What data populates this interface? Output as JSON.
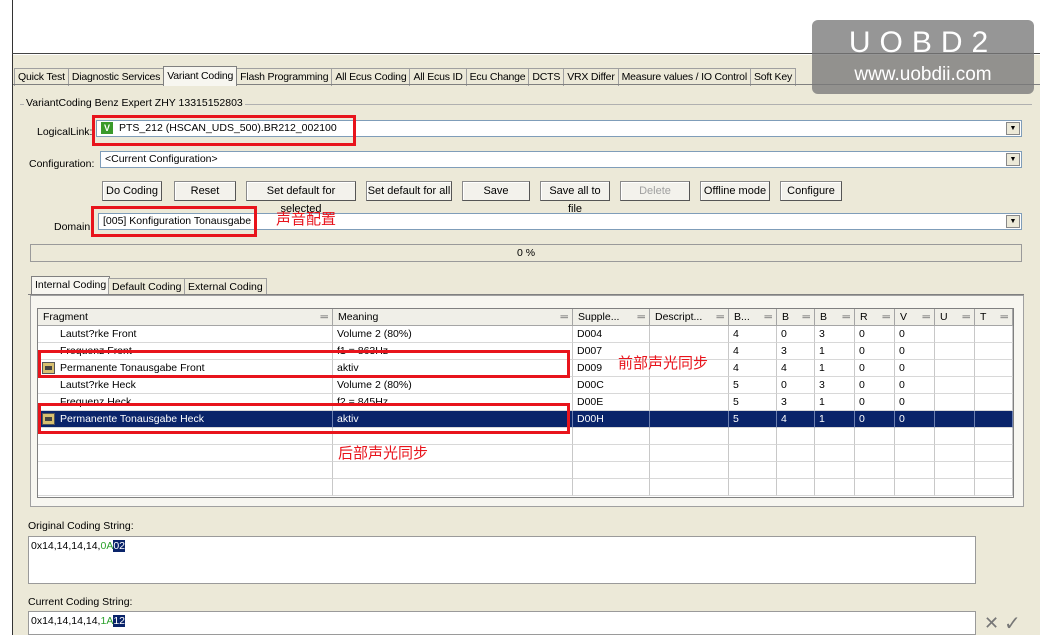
{
  "tabs": [
    "Quick Test",
    "Diagnostic Services",
    "Variant Coding",
    "Flash Programming",
    "All Ecus Coding",
    "All Ecus ID",
    "Ecu Change",
    "DCTS",
    "VRX Differ",
    "Measure values / IO Control",
    "Soft Key"
  ],
  "active_tab": "Variant Coding",
  "group_title": "VariantCoding Benz Expert ZHY 13315152803",
  "logical_link": {
    "label": "LogicalLink:",
    "badge": "V",
    "value": "PTS_212 (HSCAN_UDS_500).BR212_002100"
  },
  "configuration": {
    "label": "Configuration:",
    "value": "<Current Configuration>"
  },
  "buttons": {
    "do_coding": "Do Coding",
    "reset": "Reset",
    "set_default_selected": "Set default for selected",
    "set_default_all": "Set default for all",
    "save": "Save",
    "save_all": "Save all to file",
    "delete": "Delete",
    "offline": "Offline mode",
    "configure": "Configure"
  },
  "domain": {
    "label": "Domain:",
    "value": "[005] Konfiguration Tonausgabe"
  },
  "progress": {
    "value": 0,
    "text": "0 %"
  },
  "inner_tabs": [
    "Internal Coding",
    "Default Coding",
    "External Coding"
  ],
  "grid": {
    "columns": [
      "Fragment",
      "Meaning",
      "Supple...",
      "Descript...",
      "B...",
      "B",
      "B",
      "R",
      "V",
      "U",
      "T"
    ],
    "rows": [
      [
        "Lautst?rke Front",
        "Volume 2 (80%)",
        "D004",
        "",
        "4",
        "0",
        "3",
        "0",
        "0",
        "",
        ""
      ],
      [
        "Frequenz Front",
        "f1 = 863Hz",
        "D007",
        "",
        "4",
        "3",
        "1",
        "0",
        "0",
        "",
        ""
      ],
      [
        "Permanente Tonausgabe Front",
        "aktiv",
        "D009",
        "",
        "4",
        "4",
        "1",
        "0",
        "0",
        "",
        ""
      ],
      [
        "Lautst?rke Heck",
        "Volume 2 (80%)",
        "D00C",
        "",
        "5",
        "0",
        "3",
        "0",
        "0",
        "",
        ""
      ],
      [
        "Frequenz Heck",
        "f2 = 845Hz",
        "D00E",
        "",
        "5",
        "3",
        "1",
        "0",
        "0",
        "",
        ""
      ],
      [
        "Permanente Tonausgabe Heck",
        "aktiv",
        "D00H",
        "",
        "5",
        "4",
        "1",
        "0",
        "0",
        "",
        ""
      ]
    ]
  },
  "annotations": {
    "domain": "声音配置",
    "front": "前部声光同步",
    "rear": "后部声光同步"
  },
  "original_coding": {
    "label": "Original Coding String:",
    "prefix": "0x14,14,14,14,",
    "green": "0A",
    "highlight": "02"
  },
  "current_coding": {
    "label": "Current Coding String:",
    "prefix": "0x14,14,14,14,",
    "green": "1A",
    "highlight": "12"
  },
  "watermark": {
    "line1": "UOBD2",
    "line2": "www.uobdii.com"
  },
  "colors": {
    "annotation_red": "#e8141c",
    "selection": "#0a246a",
    "badge_green": "#3a9a2a"
  }
}
